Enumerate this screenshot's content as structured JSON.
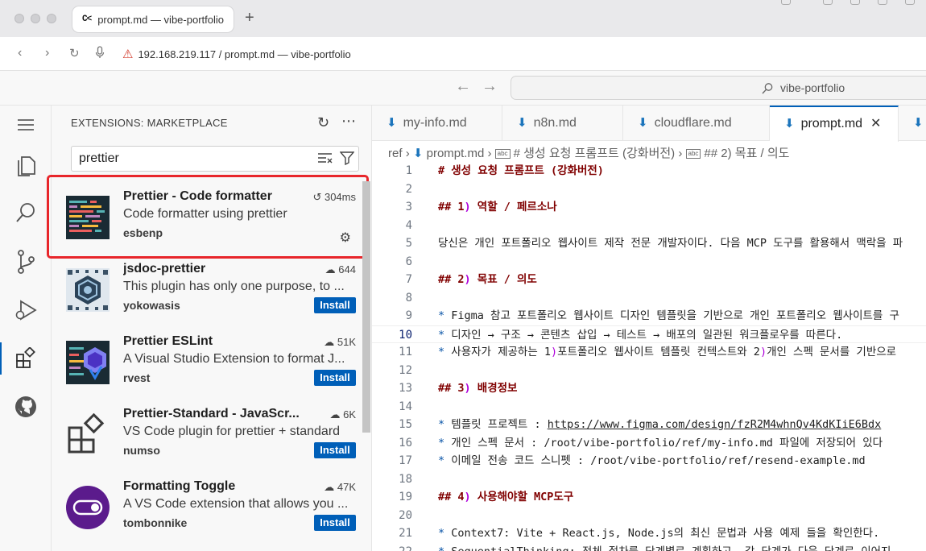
{
  "browser": {
    "tab_title": "prompt.md — vibe-portfolio",
    "favicon_text": "C<",
    "new_tab": "+",
    "url": "192.168.219.117 / prompt.md — vibe-portfolio"
  },
  "vscode": {
    "command_center": "vibe-portfolio"
  },
  "sidebar": {
    "title": "EXTENSIONS: MARKETPLACE",
    "search_value": "prettier",
    "extensions": [
      {
        "name": "Prettier - Code formatter",
        "description": "Code formatter using prettier",
        "publisher": "esbenp",
        "stat": "304ms",
        "installed": true
      },
      {
        "name": "jsdoc-prettier",
        "description": "This plugin has only one purpose, to ...",
        "publisher": "yokowasis",
        "stat": "644",
        "install_label": "Install"
      },
      {
        "name": "Prettier ESLint",
        "description": "A Visual Studio Extension to format J...",
        "publisher": "rvest",
        "stat": "51K",
        "install_label": "Install"
      },
      {
        "name": "Prettier-Standard - JavaScr...",
        "description": "VS Code plugin for prettier + standard",
        "publisher": "numso",
        "stat": "6K",
        "install_label": "Install"
      },
      {
        "name": "Formatting Toggle",
        "description": "A VS Code extension that allows you ...",
        "publisher": "tombonnike",
        "stat": "47K",
        "install_label": "Install"
      }
    ]
  },
  "editor": {
    "tabs": [
      {
        "label": "my-info.md"
      },
      {
        "label": "n8n.md"
      },
      {
        "label": "cloudflare.md"
      },
      {
        "label": "prompt.md",
        "active": true
      }
    ],
    "breadcrumb": {
      "root": "ref",
      "file": "prompt.md",
      "h1": "# 생성 요청 프롬프트 (강화버전)",
      "h2": "## 2) 목표 / 의도"
    },
    "current_line": 10,
    "lines": [
      "# 생성 요청 프롬프트 (강화버전)",
      "",
      "## 1) 역할 / 페르소나",
      "",
      "당신은 개인 포트폴리오 웹사이트 제작 전문 개발자이다. 다음 MCP 도구를 활용해서 맥락을 파",
      "",
      "## 2) 목표 / 의도",
      "",
      "* Figma 참고 포트폴리오 웹사이트 디자인 템플릿을 기반으로 개인 포트폴리오 웹사이트를 구",
      "* 디자인 → 구조 → 콘텐츠 삽입 → 테스트 → 배포의 일관된 워크플로우를 따른다.",
      "* 사용자가 제공하는 1)포트폴리오 웹사이트 템플릿 컨텍스트와 2)개인 스펙 문서를 기반으로",
      "",
      "## 3) 배경정보",
      "",
      "* 템플릿 프로젝트 : https://www.figma.com/design/fzR2M4whnQv4KdKIiE6Bdx",
      "* 개인 스펙 문서 :  /root/vibe-portfolio/ref/my-info.md 파일에 저장되어 있다",
      "* 이메일 전송 코드 스니펫 : /root/vibe-portfolio/ref/resend-example.md",
      "",
      "## 4) 사용해야할 MCP도구",
      "",
      "* Context7: Vite + React.js, Node.js의 최신 문법과 사용 예제 들을 확인한다.",
      "* SequentialThinking:  전체 절차를 단계별로 계획하고, 각 단계가 다음 단계로 이어지"
    ]
  }
}
